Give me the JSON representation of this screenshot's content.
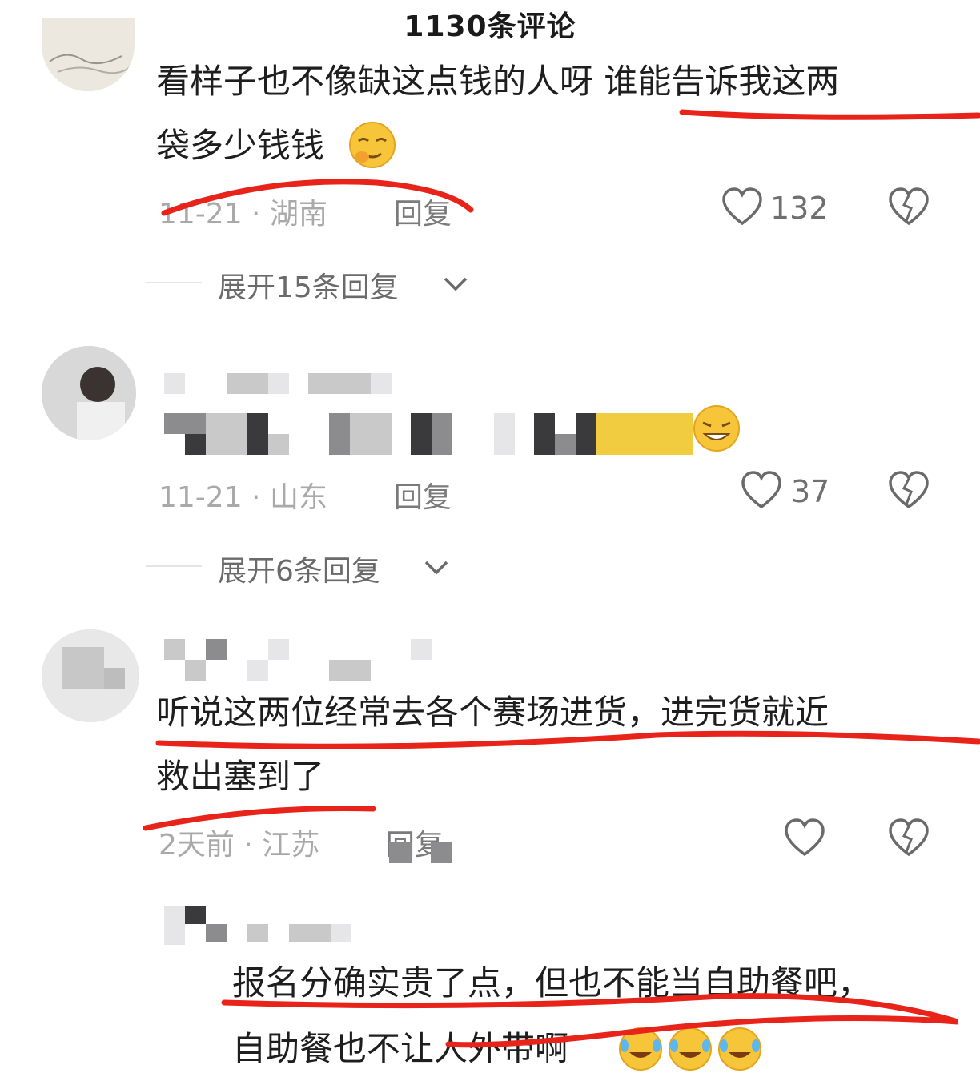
{
  "header": {
    "title": "1130条评论"
  },
  "comments": [
    {
      "text_line1": "看样子也不像缺这点钱的人呀 谁能告诉我这两",
      "text_line2": "袋多少钱钱",
      "meta": "11-21 · 湖南",
      "reply_label": "回复",
      "like_count": "132",
      "expand_label": "展开15条回复"
    },
    {
      "meta": "11-21 · 山东",
      "reply_label": "回复",
      "like_count": "37",
      "expand_label": "展开6条回复"
    },
    {
      "text_line1": "听说这两位经常去各个赛场进货，进完货就近",
      "text_line2": "救出塞到了",
      "meta": "2天前 · 江苏",
      "reply_label": "回复"
    }
  ],
  "reply": {
    "text_line1": "报名分确实贵了点，但也不能当自助餐吧，",
    "text_line2": "自助餐也不让人外带啊"
  },
  "icons": {
    "like": "heart-outline-icon",
    "dislike": "broken-heart-icon",
    "expand": "chevron-down-icon"
  },
  "colors": {
    "annotation_red": "#e8231a",
    "meta_gray": "#a9a9a9"
  }
}
